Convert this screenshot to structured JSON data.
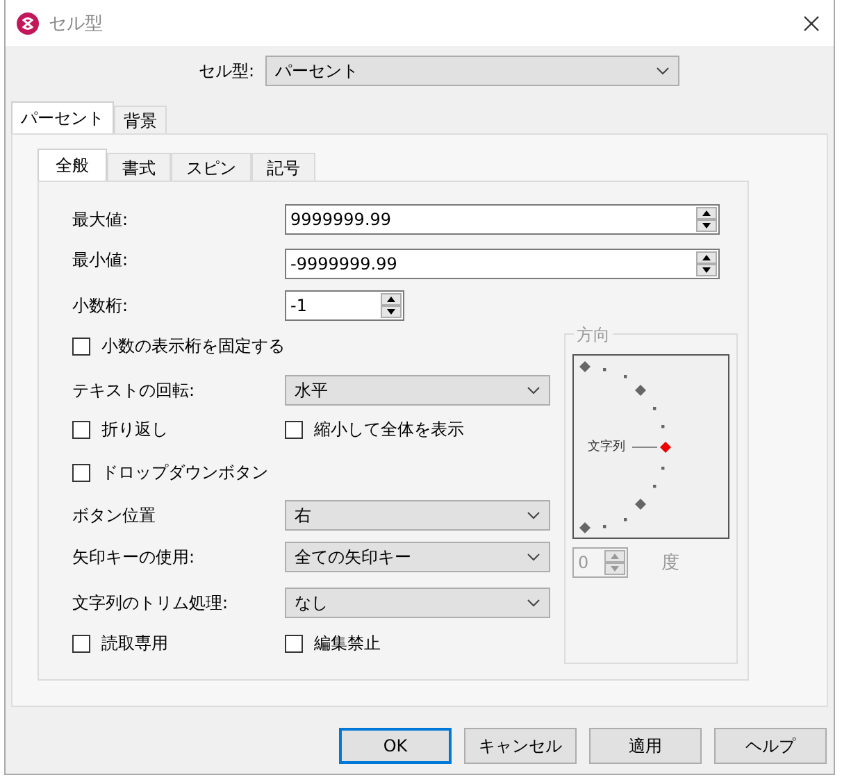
{
  "window": {
    "title": "セル型"
  },
  "cell_type": {
    "label": "セル型:",
    "value": "パーセント"
  },
  "tabs": [
    {
      "label": "パーセント",
      "selected": true
    },
    {
      "label": "背景",
      "selected": false
    }
  ],
  "subtabs": [
    {
      "label": "全般",
      "selected": true
    },
    {
      "label": "書式",
      "selected": false
    },
    {
      "label": "スピン",
      "selected": false
    },
    {
      "label": "記号",
      "selected": false
    }
  ],
  "max_value": {
    "label": "最大値:",
    "value": "9999999.99"
  },
  "min_value": {
    "label": "最小値:",
    "value": "-9999999.99"
  },
  "decimal_places": {
    "label": "小数桁:",
    "value": "-1"
  },
  "fix_decimals": {
    "label": "小数の表示桁を固定する",
    "checked": false
  },
  "text_rotation": {
    "label": "テキストの回転:",
    "value": "水平"
  },
  "wrap_text": {
    "label": "折り返し",
    "checked": false
  },
  "shrink_to_fit": {
    "label": "縮小して全体を表示",
    "checked": false
  },
  "dropdown_button": {
    "label": "ドロップダウンボタン",
    "checked": false
  },
  "button_position": {
    "label": "ボタン位置",
    "value": "右"
  },
  "arrow_keys": {
    "label": "矢印キーの使用:",
    "value": "全ての矢印キー"
  },
  "trim": {
    "label": "文字列のトリム処理:",
    "value": "なし"
  },
  "read_only": {
    "label": "読取専用",
    "checked": false
  },
  "locked": {
    "label": "編集禁止",
    "checked": false
  },
  "orientation": {
    "title": "方向",
    "label": "文字列",
    "degrees": "0",
    "unit": "度",
    "disabled": true
  },
  "buttons": [
    {
      "label": "OK",
      "default": true
    },
    {
      "label": "キャンセル",
      "default": false
    },
    {
      "label": "適用",
      "default": false
    },
    {
      "label": "ヘルプ",
      "default": false
    }
  ]
}
